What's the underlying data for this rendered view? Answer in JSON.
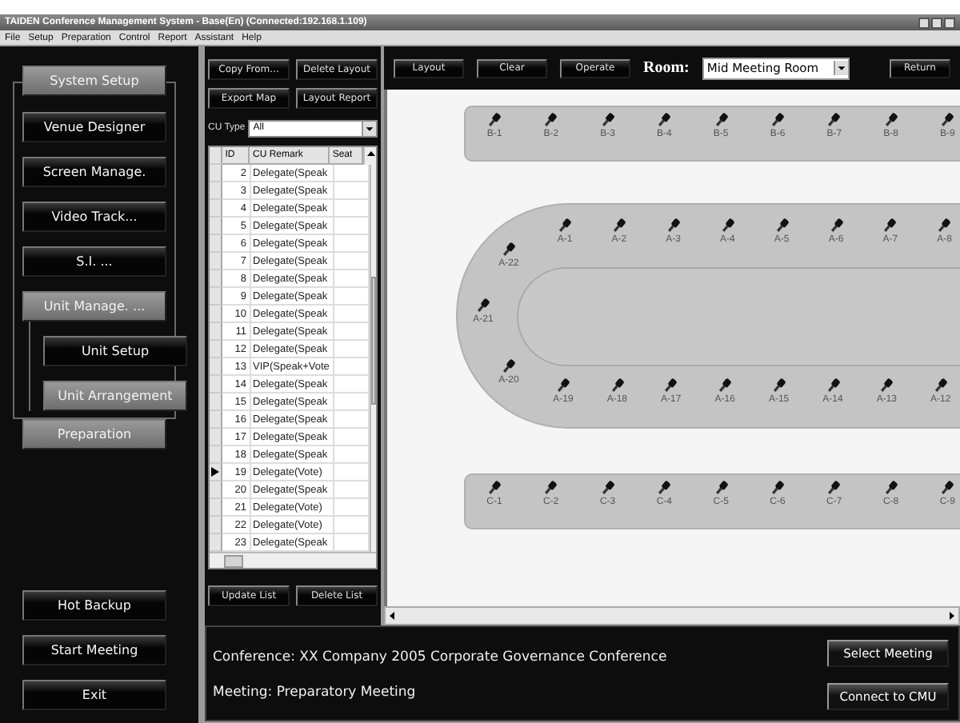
{
  "window": {
    "title": "TAIDEN Conference Management System - Base(En) (Connected:192.168.1.109)"
  },
  "menu": [
    "File",
    "Setup",
    "Preparation",
    "Control",
    "Report",
    "Assistant",
    "Help"
  ],
  "nav": {
    "items": [
      {
        "label": "System Setup",
        "active": true,
        "children": [
          {
            "label": "Venue Designer",
            "active": false
          },
          {
            "label": "Screen Manage.",
            "active": false
          },
          {
            "label": "Video Track...",
            "active": false
          },
          {
            "label": "S.I. ...",
            "active": false
          },
          {
            "label": "Unit Manage. ...",
            "active": true,
            "children": [
              {
                "label": "Unit Setup",
                "active": false
              },
              {
                "label": "Unit Arrangement",
                "active": true
              }
            ]
          }
        ]
      },
      {
        "label": "Preparation",
        "active": true
      }
    ],
    "bottom_buttons": [
      "Hot Backup",
      "Start Meeting",
      "Exit"
    ]
  },
  "unit_panel": {
    "buttons": [
      "Copy From...",
      "Delete Layout",
      "Export Map",
      "Layout Report"
    ],
    "cu_type": {
      "label": "CU Type",
      "value": "All"
    },
    "table": {
      "columns": [
        "ID",
        "CU Remark",
        "Seat"
      ],
      "rows": [
        {
          "id": "2",
          "remark": "Delegate(Speak",
          "selected": false
        },
        {
          "id": "3",
          "remark": "Delegate(Speak",
          "selected": false
        },
        {
          "id": "4",
          "remark": "Delegate(Speak",
          "selected": false
        },
        {
          "id": "5",
          "remark": "Delegate(Speak",
          "selected": false
        },
        {
          "id": "6",
          "remark": "Delegate(Speak",
          "selected": false
        },
        {
          "id": "7",
          "remark": "Delegate(Speak",
          "selected": false
        },
        {
          "id": "8",
          "remark": "Delegate(Speak",
          "selected": false
        },
        {
          "id": "9",
          "remark": "Delegate(Speak",
          "selected": false
        },
        {
          "id": "10",
          "remark": "Delegate(Speak",
          "selected": false
        },
        {
          "id": "11",
          "remark": "Delegate(Speak",
          "selected": false
        },
        {
          "id": "12",
          "remark": "Delegate(Speak",
          "selected": false
        },
        {
          "id": "13",
          "remark": "VIP(Speak+Vote",
          "selected": false
        },
        {
          "id": "14",
          "remark": "Delegate(Speak",
          "selected": false
        },
        {
          "id": "15",
          "remark": "Delegate(Speak",
          "selected": false
        },
        {
          "id": "16",
          "remark": "Delegate(Speak",
          "selected": false
        },
        {
          "id": "17",
          "remark": "Delegate(Speak",
          "selected": false
        },
        {
          "id": "18",
          "remark": "Delegate(Speak",
          "selected": false
        },
        {
          "id": "19",
          "remark": "Delegate(Vote)",
          "selected": true
        },
        {
          "id": "20",
          "remark": "Delegate(Speak",
          "selected": false
        },
        {
          "id": "21",
          "remark": "Delegate(Vote)",
          "selected": false
        },
        {
          "id": "22",
          "remark": "Delegate(Vote)",
          "selected": false
        },
        {
          "id": "23",
          "remark": "Delegate(Speak",
          "selected": false
        }
      ]
    },
    "actions": [
      "Update List",
      "Delete List"
    ]
  },
  "toolbar": {
    "buttons": [
      "Layout",
      "Clear",
      "Operate"
    ],
    "room_label": "Room:",
    "room": "Mid Meeting Room",
    "return": "Return"
  },
  "venue": {
    "tables": [
      {
        "kind": "strip",
        "seats": [
          "B-1",
          "B-2",
          "B-3",
          "B-4",
          "B-5",
          "B-6",
          "B-7",
          "B-8",
          "B-9"
        ]
      },
      {
        "kind": "oval",
        "top": [
          "A-1",
          "A-2",
          "A-3",
          "A-4",
          "A-5",
          "A-6",
          "A-7",
          "A-8"
        ],
        "left": [
          "A-22",
          "A-21",
          "A-20"
        ],
        "bottom": [
          "A-19",
          "A-18",
          "A-17",
          "A-16",
          "A-15",
          "A-14",
          "A-13",
          "A-12"
        ]
      },
      {
        "kind": "strip",
        "seats": [
          "C-1",
          "C-2",
          "C-3",
          "C-4",
          "C-5",
          "C-6",
          "C-7",
          "C-8",
          "C-9"
        ]
      }
    ]
  },
  "info": {
    "conference": "Conference: XX Company 2005 Corporate Governance Conference",
    "meeting": "Meeting: Preparatory Meeting",
    "buttons": [
      "Select Meeting",
      "Connect to CMU"
    ]
  }
}
